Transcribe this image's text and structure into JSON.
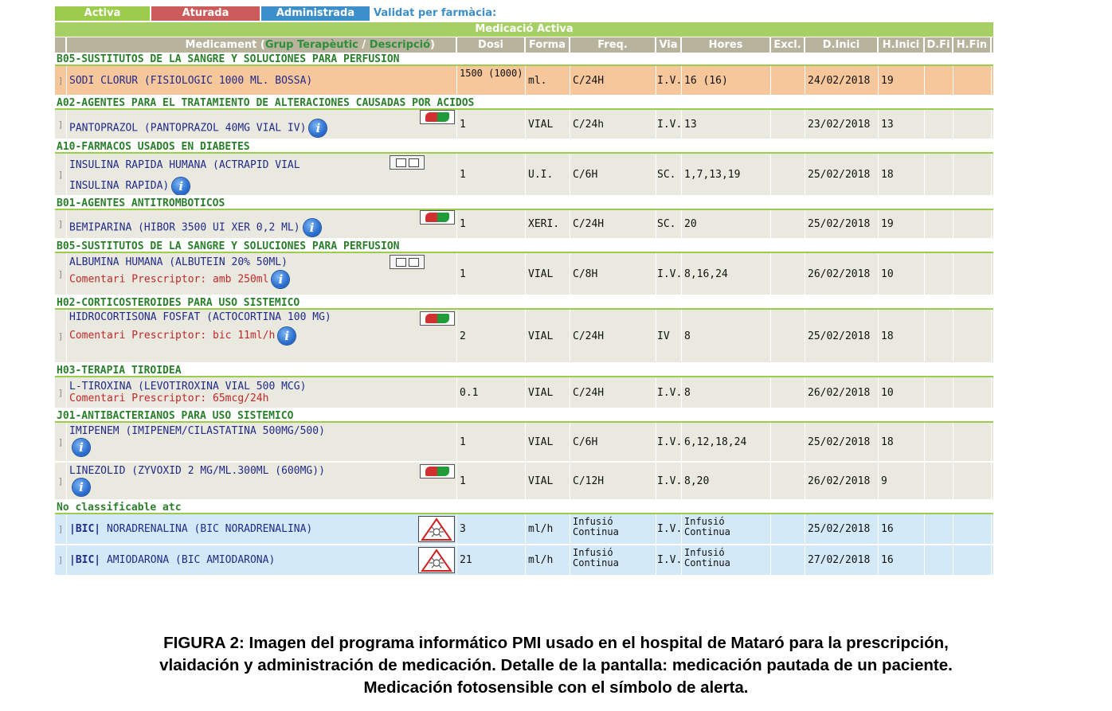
{
  "tabs": {
    "active": "Activa",
    "stopped": "Aturada",
    "administered": "Administrada",
    "validated_label": "Validat per farmàcia:"
  },
  "band_title": "Medicació Activa",
  "header": {
    "med_main": "Medicament (",
    "med_group": "Grup Terapèutic",
    "med_sep": " / ",
    "med_desc": "Descripció",
    "med_close": ")",
    "dosi": "Dosi",
    "forma": "Forma",
    "freq": "Freq.",
    "via": "Via",
    "hores": "Hores",
    "excl": "Excl.",
    "dini": "D.Inici",
    "hini": "H.Inici",
    "dfi": "D.Fi",
    "hfin": "H.Fin"
  },
  "groups": [
    "B05-SUSTITUTOS DE LA SANGRE Y SOLUCIONES PARA PERFUSION",
    "A02-AGENTES PARA EL TRATAMIENTO DE ALTERACIONES CAUSADAS POR ACIDOS",
    "A10-FARMACOS USADOS EN DIABETES",
    "B01-AGENTES ANTITROMBOTICOS",
    "B05-SUSTITUTOS DE LA SANGRE Y SOLUCIONES PARA PERFUSION",
    "H02-CORTICOSTEROIDES PARA USO SISTEMICO",
    "H03-TERAPIA TIROIDEA",
    "J01-ANTIBACTERIANOS PARA USO SISTEMICO",
    "No classificable atc"
  ],
  "rows": [
    {
      "name": "SODI CLORUR (FISIOLOGIC 1000 ML. BOSSA)",
      "dosi": "1500 (1000)",
      "forma": "ml.",
      "freq": "C/24H",
      "via": "I.V.",
      "hores": "16 (16)",
      "dini": "24/02/2018",
      "hini": "19"
    },
    {
      "name": "PANTOPRAZOL (PANTOPRAZOL 40MG VIAL IV)",
      "dosi": "1",
      "forma": "VIAL",
      "freq": "C/24h",
      "via": "I.V.",
      "hores": "13",
      "dini": "23/02/2018",
      "hini": "13"
    },
    {
      "name": "INSULINA RAPIDA HUMANA (ACTRAPID VIAL INSULINA RAPIDA)",
      "dosi": "1",
      "forma": "U.I.",
      "freq": "C/6H",
      "via": "SC.",
      "hores": "1,7,13,19",
      "dini": "25/02/2018",
      "hini": "18"
    },
    {
      "name": "BEMIPARINA (HIBOR 3500 UI XER 0,2 ML)",
      "dosi": "1",
      "forma": "XERI.",
      "freq": "C/24H",
      "via": "SC.",
      "hores": "20",
      "dini": "25/02/2018",
      "hini": "19"
    },
    {
      "name": "ALBUMINA HUMANA (ALBUTEIN 20% 50ML)",
      "comment": "Comentari Prescriptor: amb 250ml",
      "dosi": "1",
      "forma": "VIAL",
      "freq": "C/8H",
      "via": "I.V.",
      "hores": "8,16,24",
      "dini": "26/02/2018",
      "hini": "10"
    },
    {
      "name": "HIDROCORTISONA FOSFAT (ACTOCORTINA 100 MG)",
      "comment": "Comentari Prescriptor: bic 11ml/h",
      "dosi": "2",
      "forma": "VIAL",
      "freq": "C/24H",
      "via": "IV",
      "hores": "8",
      "dini": "25/02/2018",
      "hini": "18"
    },
    {
      "name": "L-TIROXINA (LEVOTIROXINA VIAL 500 MCG)",
      "comment": "Comentari Prescriptor: 65mcg/24h",
      "dosi": "0.1",
      "forma": "VIAL",
      "freq": "C/24H",
      "via": "I.V.",
      "hores": "8",
      "dini": "26/02/2018",
      "hini": "10"
    },
    {
      "name": "IMIPENEM (IMIPENEM/CILASTATINA 500MG/500)",
      "dosi": "1",
      "forma": "VIAL",
      "freq": "C/6H",
      "via": "I.V.",
      "hores": "6,12,18,24",
      "dini": "25/02/2018",
      "hini": "18"
    },
    {
      "name": "LINEZOLID (ZYVOXID 2 MG/ML.300ML (600MG))",
      "dosi": "1",
      "forma": "VIAL",
      "freq": "C/12H",
      "via": "I.V.",
      "hores": "8,20",
      "dini": "26/02/2018",
      "hini": "9"
    },
    {
      "bic": "|BIC|",
      "name": "NORADRENALINA (BIC NORADRENALINA)",
      "dosi": "3",
      "forma": "ml/h",
      "freq": "Infusió Continua",
      "via": "I.V.",
      "hores": "Infusió Continua",
      "dini": "25/02/2018",
      "hini": "16"
    },
    {
      "bic": "|BIC|",
      "name": "AMIODARONA (BIC AMIODARONA)",
      "dosi": "21",
      "forma": "ml/h",
      "freq": "Infusió Continua",
      "via": "I.V.",
      "hores": "Infusió Continua",
      "dini": "27/02/2018",
      "hini": "16"
    }
  ],
  "icons": {
    "info": "info-icon",
    "alert": "alert-icon",
    "transfer": "transfer-icon",
    "photosensitive": "photosensitive-alert-icon",
    "row_select": "row-select-marker"
  },
  "row_select_glyph": "]",
  "info_glyph": "i",
  "caption": {
    "line1": "FIGURA 2: Imagen del programa informático PMI usado en el hospital de Mataró  para la prescripción,",
    "line2": "vlaidación y administración de medicación. Detalle de la pantalla: medicación pautada de un paciente.",
    "line3": "Medicación fotosensible con el símbolo de alerta."
  }
}
